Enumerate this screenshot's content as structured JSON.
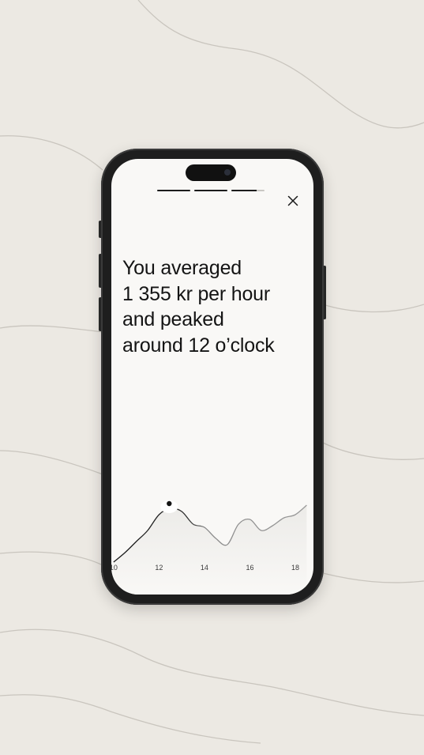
{
  "story": {
    "progress": [
      1,
      1,
      0.75
    ],
    "headline_lines": [
      "You averaged",
      "1 355 kr per hour",
      "and peaked",
      "around 12 o’clock"
    ]
  },
  "icons": {
    "close": "close-icon"
  },
  "colors": {
    "background": "#ECE9E3",
    "screen": "#F9F8F6",
    "ink": "#141414",
    "line": "#444444"
  },
  "chart_data": {
    "type": "area",
    "x": [
      10,
      10.5,
      11,
      11.5,
      12,
      12.5,
      13,
      13.5,
      14,
      14.5,
      15,
      15.5,
      16,
      16.5,
      17,
      17.5,
      18,
      18.5
    ],
    "values": [
      1000,
      1060,
      1130,
      1200,
      1300,
      1340,
      1320,
      1240,
      1220,
      1150,
      1110,
      1240,
      1270,
      1200,
      1230,
      1280,
      1300,
      1360
    ],
    "highlight": {
      "x": 12.45,
      "label": "peak"
    },
    "xticks": [
      "10",
      "12",
      "14",
      "16",
      "18"
    ],
    "xlim": [
      9.9,
      18.8
    ],
    "ylim": [
      850,
      1500
    ],
    "grid": false
  }
}
